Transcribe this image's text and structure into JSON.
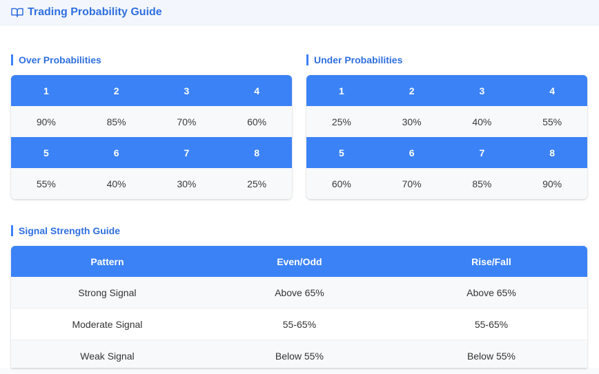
{
  "header": {
    "icon": "book-open-icon",
    "title": "Trading Probability Guide"
  },
  "over": {
    "title": "Over Probabilities",
    "rows": [
      {
        "digits": [
          "1",
          "2",
          "3",
          "4"
        ],
        "values": [
          "90%",
          "85%",
          "70%",
          "60%"
        ]
      },
      {
        "digits": [
          "5",
          "6",
          "7",
          "8"
        ],
        "values": [
          "55%",
          "40%",
          "30%",
          "25%"
        ]
      }
    ]
  },
  "under": {
    "title": "Under Probabilities",
    "rows": [
      {
        "digits": [
          "1",
          "2",
          "3",
          "4"
        ],
        "values": [
          "25%",
          "30%",
          "40%",
          "55%"
        ]
      },
      {
        "digits": [
          "5",
          "6",
          "7",
          "8"
        ],
        "values": [
          "60%",
          "70%",
          "85%",
          "90%"
        ]
      }
    ]
  },
  "signal": {
    "title": "Signal Strength Guide",
    "columns": [
      "Pattern",
      "Even/Odd",
      "Rise/Fall"
    ],
    "rows": [
      [
        "Strong Signal",
        "Above 65%",
        "Above 65%"
      ],
      [
        "Moderate Signal",
        "55-65%",
        "55-65%"
      ],
      [
        "Weak Signal",
        "Below 55%",
        "Below 55%"
      ]
    ]
  },
  "colors": {
    "accent": "#3b82f6",
    "title_text": "#2f6fe0"
  }
}
